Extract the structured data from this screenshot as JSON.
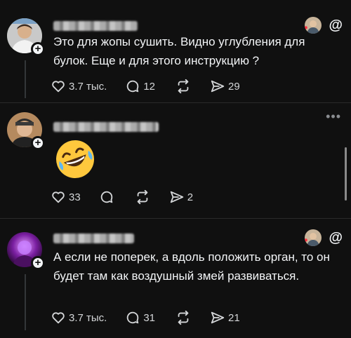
{
  "posts": [
    {
      "text": "Это для жопы сушить. Видно углубления для булок. Еще и для этого инструкцию ?",
      "likes": "3.7 тыс.",
      "replies": "12",
      "reposts": "",
      "shares": "29"
    },
    {
      "text": "🤣",
      "likes": "33",
      "replies": "",
      "reposts": "",
      "shares": "2"
    },
    {
      "text": "А если не поперек, а вдоль положить орган, то он будет там как воздушный змей развиваться.",
      "likes": "3.7 тыс.",
      "replies": "31",
      "reposts": "",
      "shares": "21"
    }
  ],
  "icons": {
    "follow": "plus-icon",
    "like": "heart-icon",
    "reply": "comment-icon",
    "repost": "repost-icon",
    "share": "send-icon",
    "app": "threads-logo-icon",
    "more": "more-icon"
  },
  "colors": {
    "background": "#101010",
    "text": "#f3f5f7",
    "heart": "#ff3040",
    "muted": "#8a8d91"
  },
  "more_label": "•••",
  "follow_label": "+",
  "threads_glyph": "@"
}
